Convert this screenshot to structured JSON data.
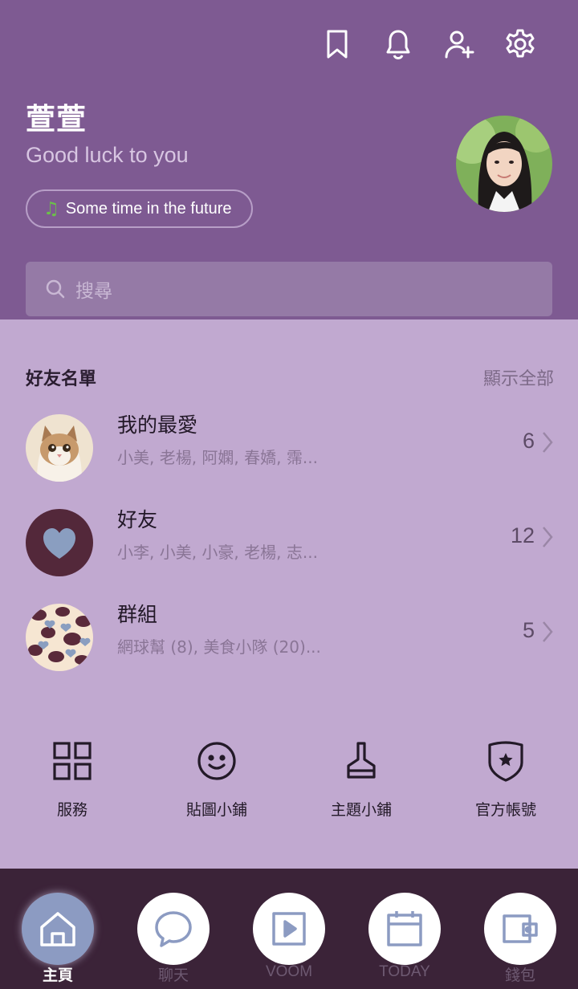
{
  "profile": {
    "name": "萱萱",
    "status": "Good luck to you",
    "music": "Some time in the future"
  },
  "top_icons": [
    "bookmark-icon",
    "bell-icon",
    "add-friend-icon",
    "gear-icon"
  ],
  "search": {
    "placeholder": "搜尋"
  },
  "friends": {
    "title": "好友名單",
    "show_all": "顯示全部",
    "rows": [
      {
        "title": "我的最愛",
        "subtitle": "小美, 老楊, 阿嫻, 春嬌, 霈...",
        "count": "6"
      },
      {
        "title": "好友",
        "subtitle": "小李, 小美, 小豪, 老楊, 志...",
        "count": "12"
      },
      {
        "title": "群組",
        "subtitle": "網球幫 (8), 美食小隊 (20)...",
        "count": "5"
      }
    ]
  },
  "services": [
    {
      "label": "服務",
      "icon": "grid-icon"
    },
    {
      "label": "貼圖小鋪",
      "icon": "smiley-icon"
    },
    {
      "label": "主題小鋪",
      "icon": "brush-icon"
    },
    {
      "label": "官方帳號",
      "icon": "shield-star-icon"
    }
  ],
  "tabs": [
    {
      "label": "主頁",
      "icon": "home-icon",
      "active": true
    },
    {
      "label": "聊天",
      "icon": "chat-icon",
      "active": false
    },
    {
      "label": "VOOM",
      "icon": "play-icon",
      "active": false
    },
    {
      "label": "TODAY",
      "icon": "calendar-icon",
      "active": false
    },
    {
      "label": "錢包",
      "icon": "wallet-icon",
      "active": false
    }
  ],
  "colors": {
    "header_bg": "#7e5a92",
    "content_bg": "#c1a9d0",
    "tabbar_bg": "#3b2338",
    "active_tab": "#8c9bc2"
  }
}
